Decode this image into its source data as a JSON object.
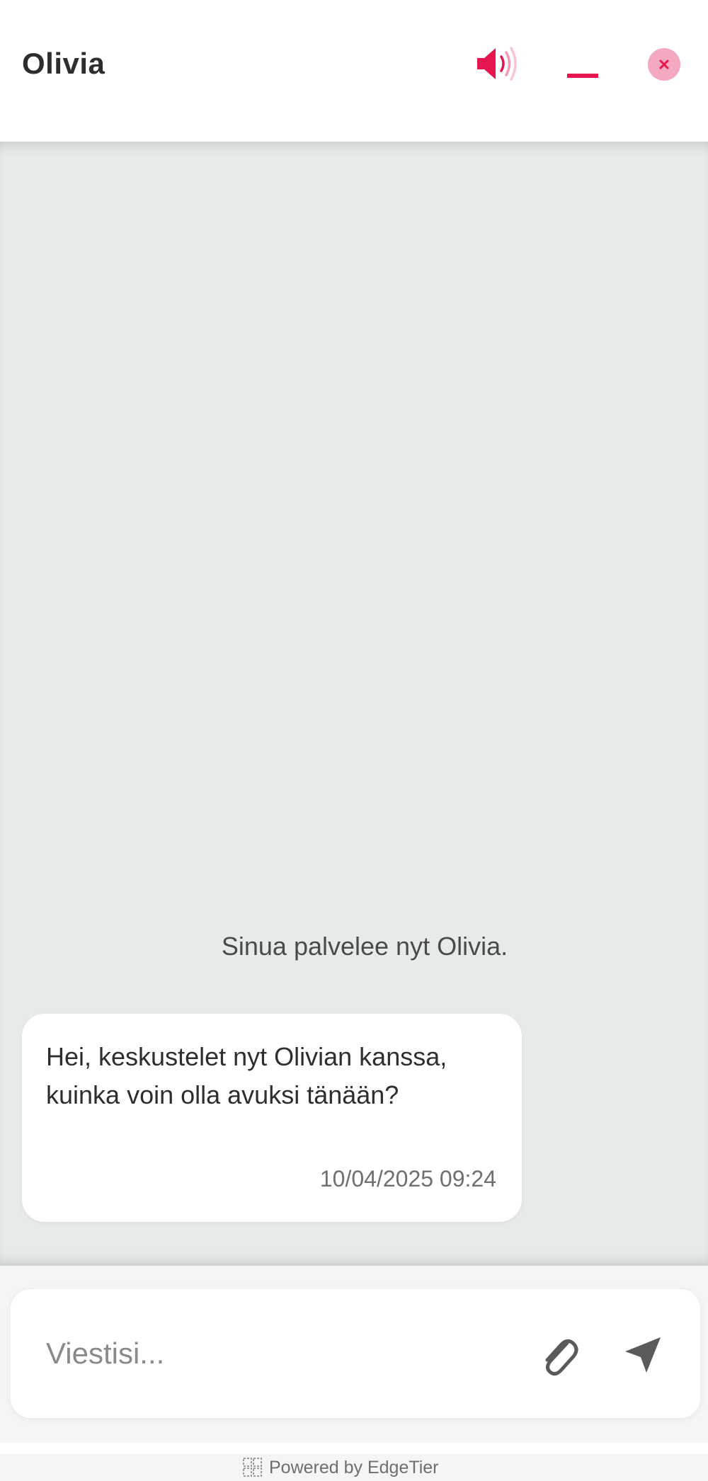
{
  "header": {
    "agent_name": "Olivia"
  },
  "messages": {
    "system_note": "Sinua palvelee nyt Olivia.",
    "agent_message": {
      "text": "Hei, keskustelet nyt Olivian kanssa, kuinka voin olla avuksi tänään?",
      "timestamp": "10/04/2025 09:24"
    }
  },
  "composer": {
    "placeholder": "Viestisi..."
  },
  "footer": {
    "powered_by": "Powered by EdgeTier"
  },
  "icons": {
    "sound": "speaker-volume-icon",
    "minimize": "minimize-icon",
    "close": "close-icon",
    "attach": "paperclip-icon",
    "send": "send-arrow-icon",
    "brand": "edgetier-logo-icon"
  },
  "colors": {
    "accent": "#e6144f",
    "accent_light": "#f5a9c0",
    "chat_background": "#e7eaeb",
    "icon_gray": "#5a5a5a"
  }
}
